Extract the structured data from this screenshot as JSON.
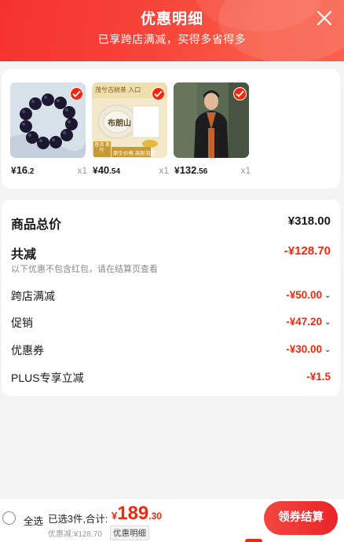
{
  "header": {
    "title": "优惠明细",
    "subtitle": "已享跨店满减，买得多省得多"
  },
  "products": [
    {
      "price_yen": "¥",
      "price_int": "16",
      "price_dec": ".2",
      "qty": "x1",
      "image": "beaded-bracelet-image",
      "selected": true
    },
    {
      "price_yen": "¥",
      "price_int": "40",
      "price_dec": ".54",
      "qty": "x1",
      "image": "puer-tea-cake-image",
      "image_text_top": "茂兮古树茶 入口",
      "image_text_cake": "布朗山",
      "image_text_badge1": "普洱 茶叶",
      "image_text_badge2": "原生价格 高耐泡度",
      "selected": true
    },
    {
      "price_yen": "¥",
      "price_int": "132",
      "price_dec": ".56",
      "qty": "x1",
      "image": "jacket-model-photo",
      "selected": true
    }
  ],
  "summary": {
    "total_label": "商品总价",
    "total_value": "¥318.00",
    "reduce_label": "共减",
    "reduce_value": "-¥128.70",
    "note": "以下优惠不包含红包，请在结算页查看",
    "items": [
      {
        "label": "跨店满减",
        "value": "-¥50.00",
        "expandable": true
      },
      {
        "label": "促销",
        "value": "-¥47.20",
        "expandable": true
      },
      {
        "label": "优惠券",
        "value": "-¥30.00",
        "expandable": true
      },
      {
        "label": "PLUS专享立减",
        "value": "-¥1.5",
        "expandable": false
      }
    ]
  },
  "footer": {
    "select_all": "全选",
    "selected_count": "已选3件,合计:",
    "total_yen": "¥",
    "total_int": "189",
    "total_dec": ".30",
    "discount_text": "优惠减:¥128.70",
    "detail_label": "优惠明细",
    "checkout_label": "领券结算"
  },
  "colors": {
    "accent": "#f2270c",
    "header_start": "#f5332f",
    "header_end": "#f9614d"
  }
}
